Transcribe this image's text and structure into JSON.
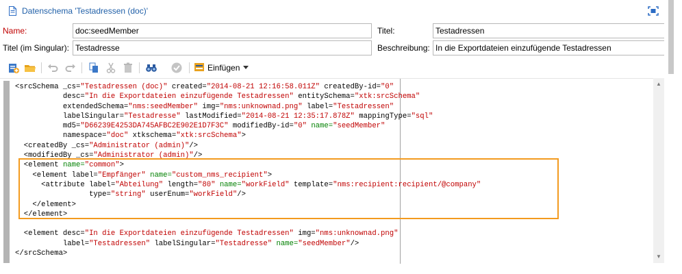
{
  "window": {
    "title": "Datenschema 'Testadressen (doc)'",
    "icons": {
      "doc": "document-icon",
      "maximize": "maximize-icon"
    }
  },
  "form": {
    "name_label": "Name:",
    "name_value": "doc:seedMember",
    "titel_label": "Titel:",
    "titel_value": "Testadressen",
    "titel_singular_label": "Titel (im Singular):",
    "titel_singular_value": "Testadresse",
    "beschreibung_label": "Beschreibung:",
    "beschreibung_value": "In die Exportdateien einzufügende Testadressen"
  },
  "toolbar": {
    "icons": [
      "new-entity-icon",
      "open-folder-icon",
      "undo-icon",
      "redo-icon",
      "copy-icon",
      "cut-icon",
      "delete-icon",
      "find-icon",
      "validate-icon",
      "insert-icon"
    ],
    "insert_label": "Einfügen"
  },
  "colors": {
    "title_blue": "#1f5fa8",
    "required_red": "#c00000",
    "xml_value_red": "#c00000",
    "xml_name_green": "#008000",
    "highlight_orange": "#f39a1e"
  },
  "code": {
    "lines": [
      [
        {
          "t": "<srcSchema _cs="
        },
        {
          "v": "\"Testadressen (doc)\""
        },
        {
          "t": " created="
        },
        {
          "v": "\"2014-08-21 12:16:58.011Z\""
        },
        {
          "t": " createdBy-id="
        },
        {
          "v": "\"0\""
        }
      ],
      [
        {
          "t": "           desc="
        },
        {
          "v": "\"In die Exportdateien einzufügende Testadressen\""
        },
        {
          "t": " entitySchema="
        },
        {
          "v": "\"xtk:srcSchema\""
        }
      ],
      [
        {
          "t": "           extendedSchema="
        },
        {
          "v": "\"nms:seedMember\""
        },
        {
          "t": " img="
        },
        {
          "v": "\"nms:unknownad.png\""
        },
        {
          "t": " label="
        },
        {
          "v": "\"Testadressen\""
        }
      ],
      [
        {
          "t": "           labelSingular="
        },
        {
          "v": "\"Testadresse\""
        },
        {
          "t": " lastModified="
        },
        {
          "v": "\"2014-08-21 12:35:17.878Z\""
        },
        {
          "t": " mappingType="
        },
        {
          "v": "\"sql\""
        }
      ],
      [
        {
          "t": "           md5="
        },
        {
          "v": "\"D66239E4253DA745AFBC2E902E1D7F3C\""
        },
        {
          "t": " modifiedBy-id="
        },
        {
          "v": "\"0\""
        },
        {
          "t": " "
        },
        {
          "g": "name="
        },
        {
          "v": "\"seedMember\""
        }
      ],
      [
        {
          "t": "           namespace="
        },
        {
          "v": "\"doc\""
        },
        {
          "t": " xtkschema="
        },
        {
          "v": "\"xtk:srcSchema\""
        },
        {
          "t": ">"
        }
      ],
      [
        {
          "t": "  <createdBy _cs="
        },
        {
          "v": "\"Administrator (admin)\""
        },
        {
          "t": "/>"
        }
      ],
      [
        {
          "t": "  <modifiedBy _cs="
        },
        {
          "v": "\"Administrator (admin)\""
        },
        {
          "t": "/>"
        }
      ],
      [
        {
          "t": "  <element "
        },
        {
          "g": "name="
        },
        {
          "v": "\"common\""
        },
        {
          "t": ">"
        }
      ],
      [
        {
          "t": "    <element label="
        },
        {
          "v": "\"Empfänger\""
        },
        {
          "t": " "
        },
        {
          "g": "name="
        },
        {
          "v": "\"custom_nms_recipient\""
        },
        {
          "t": ">"
        }
      ],
      [
        {
          "t": "      <attribute label="
        },
        {
          "v": "\"Abteilung\""
        },
        {
          "t": " length="
        },
        {
          "v": "\"80\""
        },
        {
          "t": " "
        },
        {
          "g": "name="
        },
        {
          "v": "\"workField\""
        },
        {
          "t": " template="
        },
        {
          "v": "\"nms:recipient:recipient/@company\""
        }
      ],
      [
        {
          "t": "                 type="
        },
        {
          "v": "\"string\""
        },
        {
          "t": " userEnum="
        },
        {
          "v": "\"workField\""
        },
        {
          "t": "/>"
        }
      ],
      [
        {
          "t": "    </element>"
        }
      ],
      [
        {
          "t": "  </element>"
        }
      ],
      [
        {
          "t": ""
        }
      ],
      [
        {
          "t": "  <element desc="
        },
        {
          "v": "\"In die Exportdateien einzufügende Testadressen\""
        },
        {
          "t": " img="
        },
        {
          "v": "\"nms:unknownad.png\""
        }
      ],
      [
        {
          "t": "           label="
        },
        {
          "v": "\"Testadressen\""
        },
        {
          "t": " labelSingular="
        },
        {
          "v": "\"Testadresse\""
        },
        {
          "t": " "
        },
        {
          "g": "name="
        },
        {
          "v": "\"seedMember\""
        },
        {
          "t": "/>"
        }
      ],
      [
        {
          "t": "</srcSchema>"
        }
      ]
    ]
  }
}
